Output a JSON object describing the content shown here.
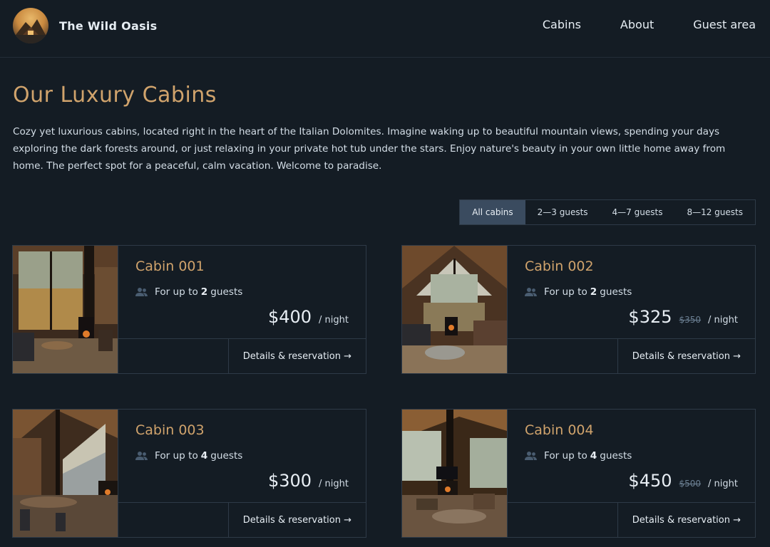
{
  "header": {
    "brand": "The Wild Oasis",
    "nav": [
      {
        "label": "Cabins"
      },
      {
        "label": "About"
      },
      {
        "label": "Guest area"
      }
    ]
  },
  "main": {
    "title": "Our Luxury Cabins",
    "intro": "Cozy yet luxurious cabins, located right in the heart of the Italian Dolomites. Imagine waking up to beautiful mountain views, spending your days exploring the dark forests around, or just relaxing in your private hot tub under the stars. Enjoy nature's beauty in your own little home away from home. The perfect spot for a peaceful, calm vacation. Welcome to paradise.",
    "filters": [
      {
        "label": "All cabins",
        "active": true
      },
      {
        "label": "2—3 guests",
        "active": false
      },
      {
        "label": "4—7 guests",
        "active": false
      },
      {
        "label": "8—12 guests",
        "active": false
      }
    ],
    "cabins": [
      {
        "name": "Cabin 001",
        "capacity_prefix": "For up to",
        "capacity": "2",
        "capacity_suffix": "guests",
        "price": "$400",
        "old_price": "",
        "unit": "/ night",
        "link": "Details & reservation →"
      },
      {
        "name": "Cabin 002",
        "capacity_prefix": "For up to",
        "capacity": "2",
        "capacity_suffix": "guests",
        "price": "$325",
        "old_price": "$350",
        "unit": "/ night",
        "link": "Details & reservation →"
      },
      {
        "name": "Cabin 003",
        "capacity_prefix": "For up to",
        "capacity": "4",
        "capacity_suffix": "guests",
        "price": "$300",
        "old_price": "",
        "unit": "/ night",
        "link": "Details & reservation →"
      },
      {
        "name": "Cabin 004",
        "capacity_prefix": "For up to",
        "capacity": "4",
        "capacity_suffix": "guests",
        "price": "$450",
        "old_price": "$500",
        "unit": "/ night",
        "link": "Details & reservation →"
      }
    ]
  },
  "colors": {
    "background": "#141c24",
    "accent": "#d0a36c",
    "border": "#2e3a47",
    "active_filter": "#3a4b5f"
  }
}
